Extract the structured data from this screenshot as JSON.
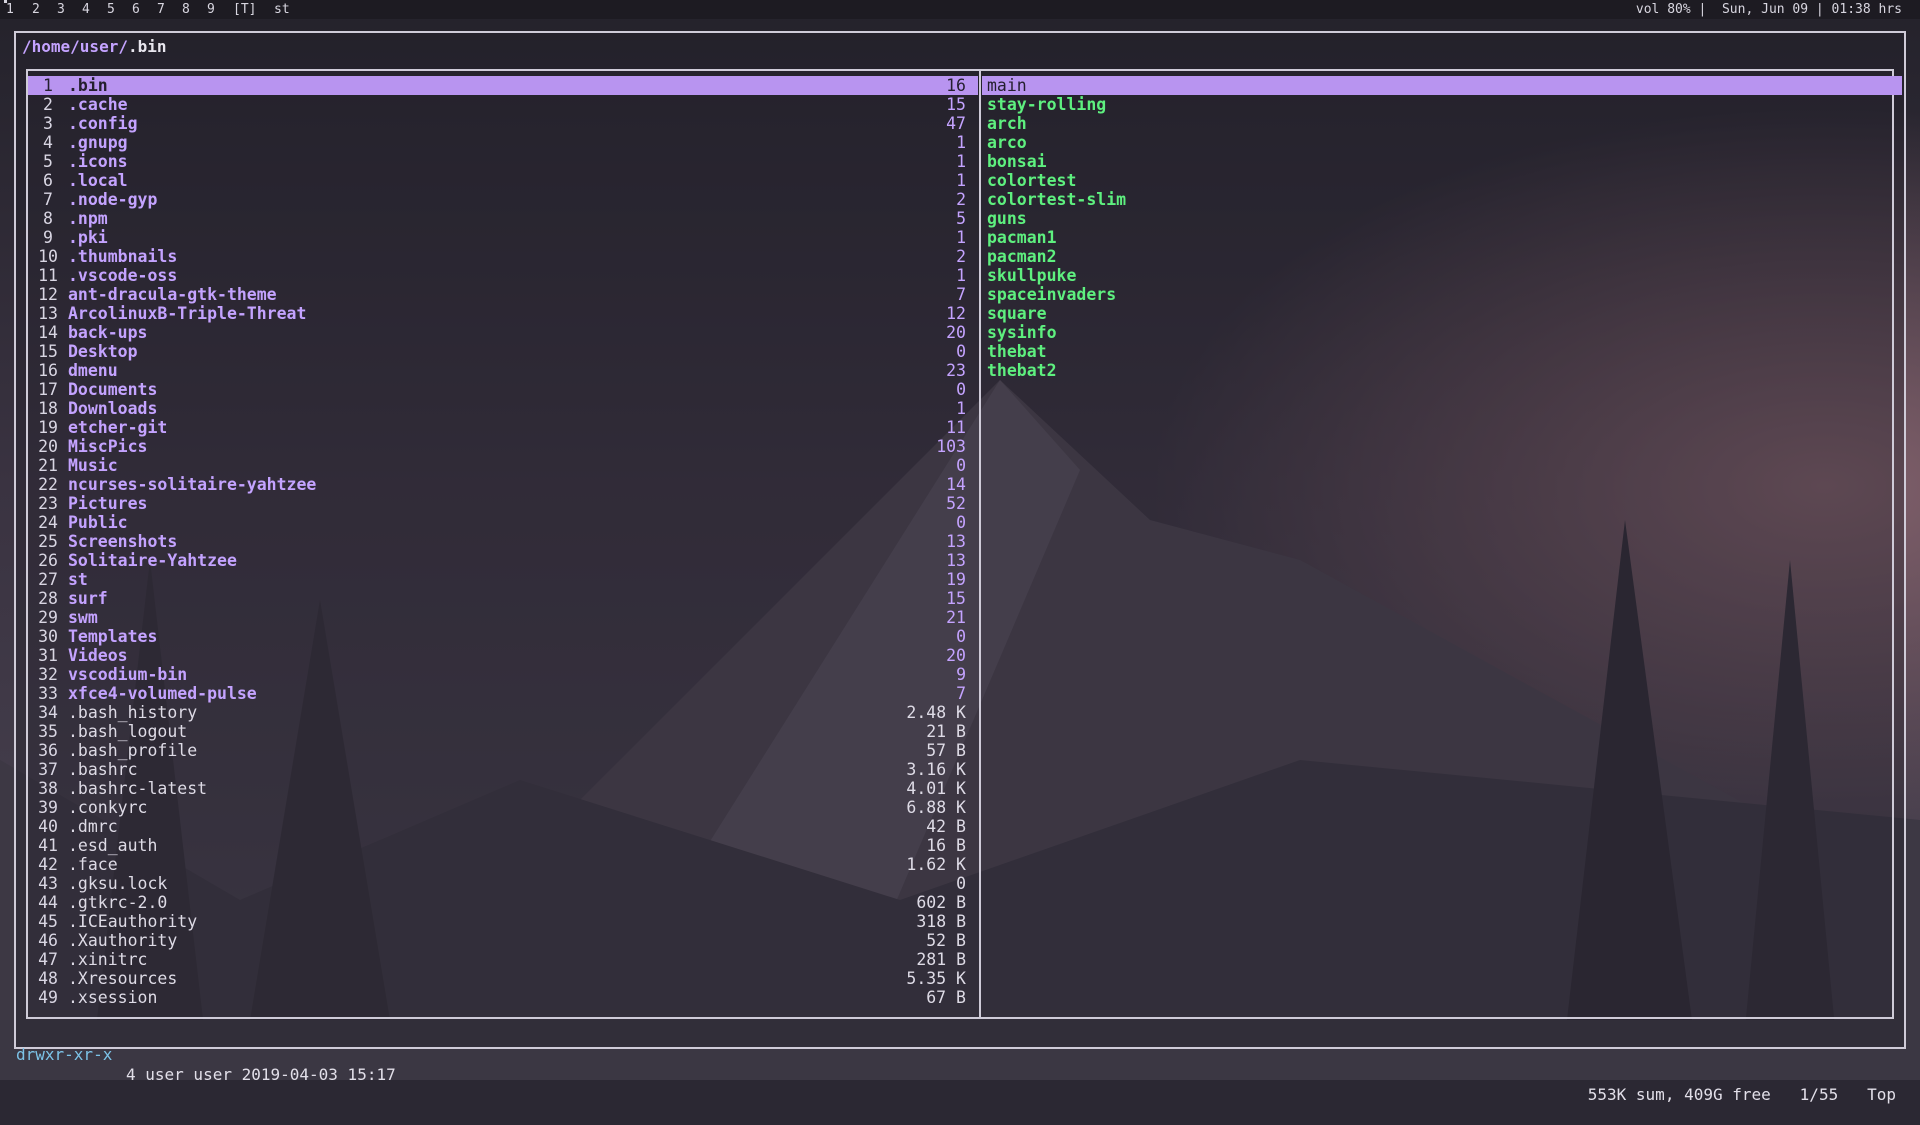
{
  "topbar": {
    "workspaces": [
      "1",
      "2",
      "3",
      "4",
      "5",
      "6",
      "7",
      "8",
      "9"
    ],
    "layout": "[T]",
    "window_title": "st",
    "status": "vol 80% |  Sun, Jun 09 | 01:38 hrs"
  },
  "path": {
    "dir": "/home/user/",
    "current": ".bin"
  },
  "left_pane": [
    {
      "num": "1",
      "name": ".bin",
      "size": "16",
      "type": "dir",
      "selected": true
    },
    {
      "num": "2",
      "name": ".cache",
      "size": "15",
      "type": "dir"
    },
    {
      "num": "3",
      "name": ".config",
      "size": "47",
      "type": "dir"
    },
    {
      "num": "4",
      "name": ".gnupg",
      "size": "1",
      "type": "dir"
    },
    {
      "num": "5",
      "name": ".icons",
      "size": "1",
      "type": "dir"
    },
    {
      "num": "6",
      "name": ".local",
      "size": "1",
      "type": "dir"
    },
    {
      "num": "7",
      "name": ".node-gyp",
      "size": "2",
      "type": "dir"
    },
    {
      "num": "8",
      "name": ".npm",
      "size": "5",
      "type": "dir"
    },
    {
      "num": "9",
      "name": ".pki",
      "size": "1",
      "type": "dir"
    },
    {
      "num": "10",
      "name": ".thumbnails",
      "size": "2",
      "type": "dir"
    },
    {
      "num": "11",
      "name": ".vscode-oss",
      "size": "1",
      "type": "dir"
    },
    {
      "num": "12",
      "name": "ant-dracula-gtk-theme",
      "size": "7",
      "type": "dir"
    },
    {
      "num": "13",
      "name": "ArcolinuxB-Triple-Threat",
      "size": "12",
      "type": "dir"
    },
    {
      "num": "14",
      "name": "back-ups",
      "size": "20",
      "type": "dir"
    },
    {
      "num": "15",
      "name": "Desktop",
      "size": "0",
      "type": "dir"
    },
    {
      "num": "16",
      "name": "dmenu",
      "size": "23",
      "type": "dir"
    },
    {
      "num": "17",
      "name": "Documents",
      "size": "0",
      "type": "dir"
    },
    {
      "num": "18",
      "name": "Downloads",
      "size": "1",
      "type": "dir"
    },
    {
      "num": "19",
      "name": "etcher-git",
      "size": "11",
      "type": "dir"
    },
    {
      "num": "20",
      "name": "MiscPics",
      "size": "103",
      "type": "dir"
    },
    {
      "num": "21",
      "name": "Music",
      "size": "0",
      "type": "dir"
    },
    {
      "num": "22",
      "name": "ncurses-solitaire-yahtzee",
      "size": "14",
      "type": "dir"
    },
    {
      "num": "23",
      "name": "Pictures",
      "size": "52",
      "type": "dir"
    },
    {
      "num": "24",
      "name": "Public",
      "size": "0",
      "type": "dir"
    },
    {
      "num": "25",
      "name": "Screenshots",
      "size": "13",
      "type": "dir"
    },
    {
      "num": "26",
      "name": "Solitaire-Yahtzee",
      "size": "13",
      "type": "dir"
    },
    {
      "num": "27",
      "name": "st",
      "size": "19",
      "type": "dir"
    },
    {
      "num": "28",
      "name": "surf",
      "size": "15",
      "type": "dir"
    },
    {
      "num": "29",
      "name": "swm",
      "size": "21",
      "type": "dir"
    },
    {
      "num": "30",
      "name": "Templates",
      "size": "0",
      "type": "dir"
    },
    {
      "num": "31",
      "name": "Videos",
      "size": "20",
      "type": "dir"
    },
    {
      "num": "32",
      "name": "vscodium-bin",
      "size": "9",
      "type": "dir"
    },
    {
      "num": "33",
      "name": "xfce4-volumed-pulse",
      "size": "7",
      "type": "dir"
    },
    {
      "num": "34",
      "name": ".bash_history",
      "size": "2.48 K",
      "type": "file"
    },
    {
      "num": "35",
      "name": ".bash_logout",
      "size": "21 B",
      "type": "file"
    },
    {
      "num": "36",
      "name": ".bash_profile",
      "size": "57 B",
      "type": "file"
    },
    {
      "num": "37",
      "name": ".bashrc",
      "size": "3.16 K",
      "type": "file"
    },
    {
      "num": "38",
      "name": ".bashrc-latest",
      "size": "4.01 K",
      "type": "file"
    },
    {
      "num": "39",
      "name": ".conkyrc",
      "size": "6.88 K",
      "type": "file"
    },
    {
      "num": "40",
      "name": ".dmrc",
      "size": "42 B",
      "type": "file"
    },
    {
      "num": "41",
      "name": ".esd_auth",
      "size": "16 B",
      "type": "file"
    },
    {
      "num": "42",
      "name": ".face",
      "size": "1.62 K",
      "type": "file"
    },
    {
      "num": "43",
      "name": ".gksu.lock",
      "size": "0",
      "type": "file"
    },
    {
      "num": "44",
      "name": ".gtkrc-2.0",
      "size": "602 B",
      "type": "file"
    },
    {
      "num": "45",
      "name": ".ICEauthority",
      "size": "318 B",
      "type": "file"
    },
    {
      "num": "46",
      "name": ".Xauthority",
      "size": "52 B",
      "type": "file"
    },
    {
      "num": "47",
      "name": ".xinitrc",
      "size": "281 B",
      "type": "file"
    },
    {
      "num": "48",
      "name": ".Xresources",
      "size": "5.35 K",
      "type": "file"
    },
    {
      "num": "49",
      "name": ".xsession",
      "size": "67 B",
      "type": "file"
    }
  ],
  "right_pane": [
    {
      "name": "main",
      "selected": true
    },
    {
      "name": "stay-rolling"
    },
    {
      "name": "arch"
    },
    {
      "name": "arco"
    },
    {
      "name": "bonsai"
    },
    {
      "name": "colortest"
    },
    {
      "name": "colortest-slim"
    },
    {
      "name": "guns"
    },
    {
      "name": "pacman1"
    },
    {
      "name": "pacman2"
    },
    {
      "name": "skullpuke"
    },
    {
      "name": "spaceinvaders"
    },
    {
      "name": "square"
    },
    {
      "name": "sysinfo"
    },
    {
      "name": "thebat"
    },
    {
      "name": "thebat2"
    }
  ],
  "statusline": {
    "permissions": "drwxr-xr-x",
    "meta": "4 user user 2019-04-03 15:17",
    "sum_free": "553K sum, 409G free   1/55   Top"
  },
  "colors": {
    "dir": "#c4a3ff",
    "exe": "#5ef07f",
    "selection": "#b894f0",
    "permissions": "#7cc3e8"
  }
}
